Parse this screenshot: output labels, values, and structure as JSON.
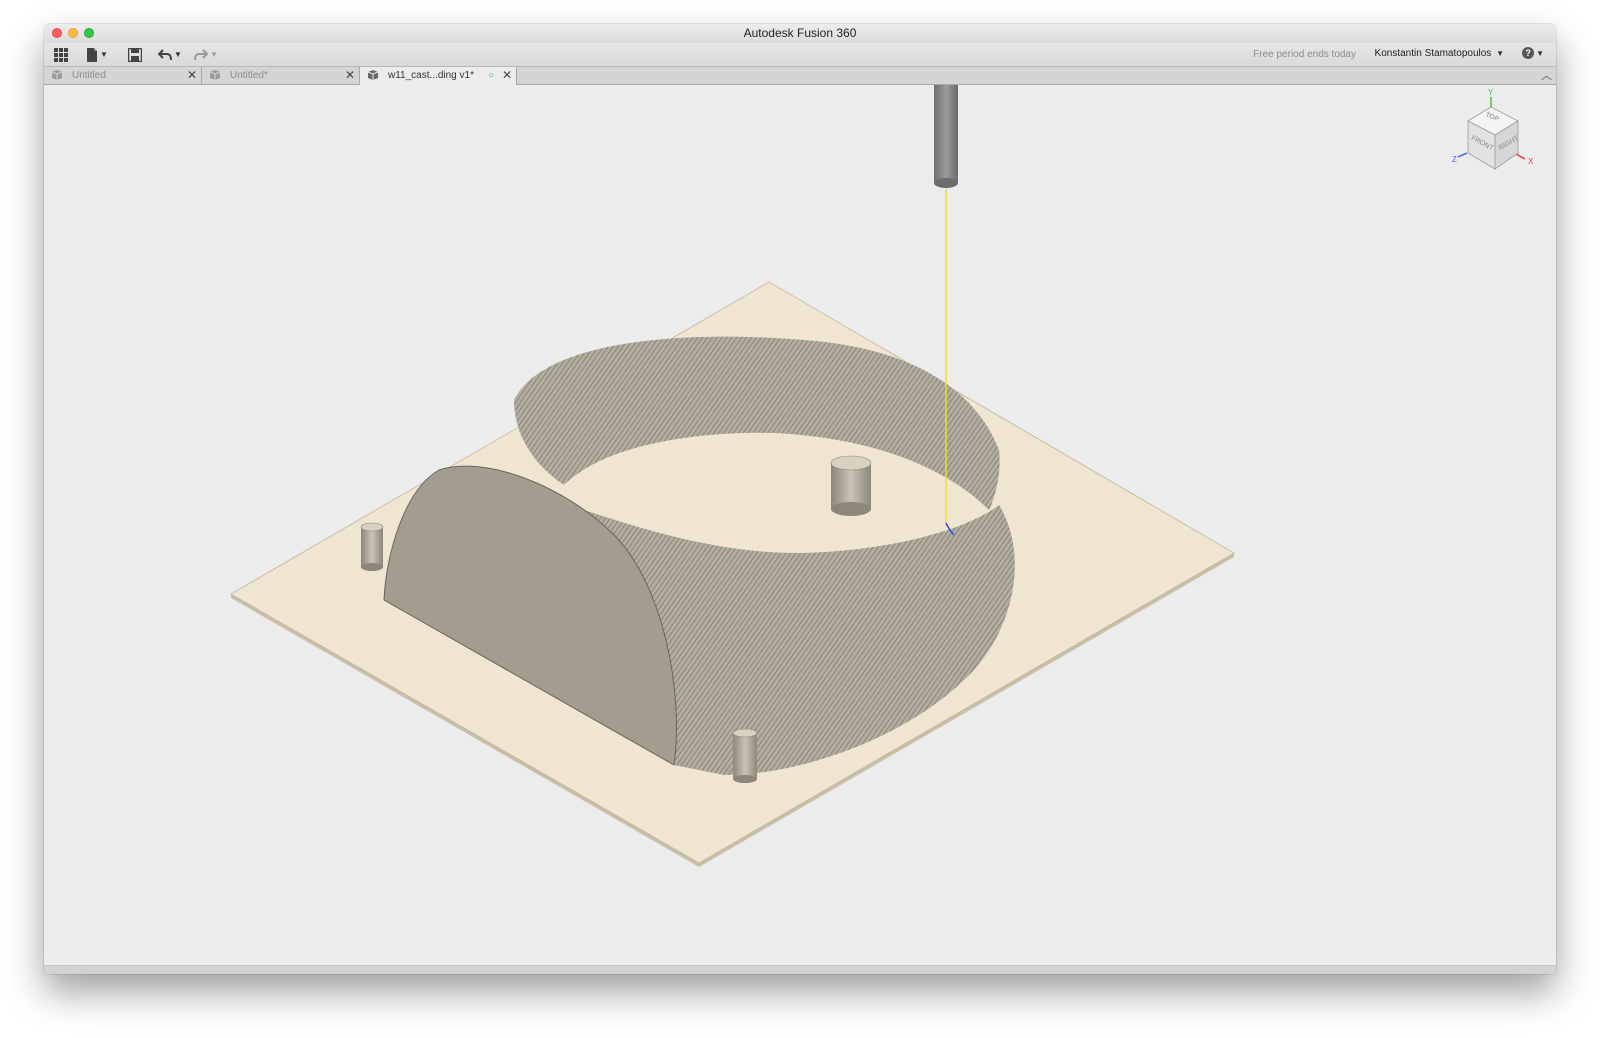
{
  "window": {
    "title": "Autodesk Fusion 360"
  },
  "toolbar": {
    "free_period": "Free period ends today",
    "user_name": "Konstantin Stamatopoulos",
    "help_symbol": "?",
    "icons": [
      "app-grid-icon",
      "file-icon",
      "save-icon",
      "undo-icon",
      "redo-icon"
    ]
  },
  "tabs": [
    {
      "label": "Untitled",
      "active": false
    },
    {
      "label": "Untitled*",
      "active": false
    },
    {
      "label": "w11_cast...ding v1*",
      "active": true,
      "status_symbol": "○"
    }
  ],
  "viewcube": {
    "faces": {
      "top": "TOP",
      "front": "FRONT",
      "right": "RIGHT"
    },
    "axes": {
      "x": "X",
      "y": "Y",
      "z": "Z"
    },
    "axis_colors": {
      "x": "#e23a3a",
      "y": "#3ec43e",
      "z": "#3a5fe2"
    }
  },
  "scene": {
    "colors": {
      "stock": "#efe5d1",
      "model": "#a39d8f",
      "model_dark": "#8f897c",
      "tool": "#8a8a8a",
      "toolpath": "#f0e020",
      "background": "#ececec"
    }
  }
}
